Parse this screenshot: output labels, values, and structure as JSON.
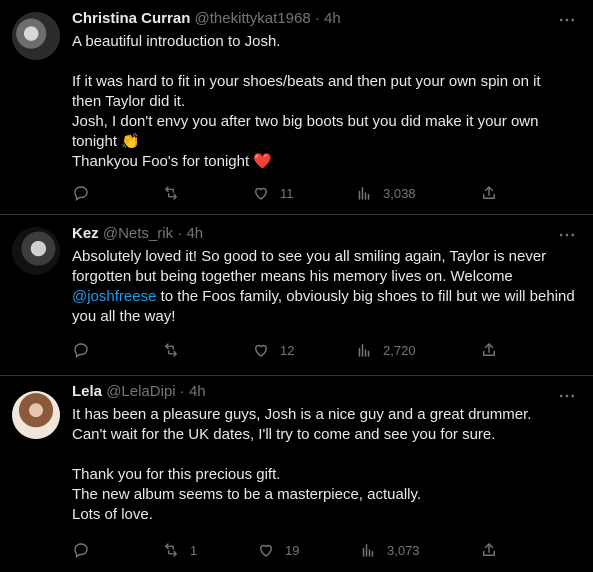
{
  "tweets": [
    {
      "name": "Christina Curran",
      "handle": "@thekittykat1968",
      "dot": "·",
      "time": "4h",
      "text_lines": [
        "A beautiful introduction to Josh.",
        "",
        "If it was hard to fit in your shoes/beats and then put your own spin on it",
        "then Taylor did it.",
        "Josh, I don't envy you after two big boots but you did make it your own",
        "tonight 👏",
        "Thankyou Foo's for tonight ❤️"
      ],
      "actions": {
        "reply": "",
        "retweet": "",
        "like": "11",
        "views": "3,038"
      }
    },
    {
      "name": "Kez",
      "handle": "@Nets_rik",
      "dot": "·",
      "time": "4h",
      "text_before_mention": "Absolutely loved it! So good to see you all smiling again, Taylor is never forgotten but being together means his memory lives on. Welcome",
      "mention": "@joshfreese",
      "text_after_mention": "to the Foos family, obviously big shoes to fill but we will behind you all the way!",
      "actions": {
        "reply": "",
        "retweet": "",
        "like": "12",
        "views": "2,720"
      }
    },
    {
      "name": "Lela",
      "handle": "@LelaDipi",
      "dot": "·",
      "time": "4h",
      "text_lines": [
        "It has been a pleasure guys, Josh is a nice guy and a great drummer.",
        "Can't wait for the UK dates, I'll try to come and see you for sure.",
        "",
        "Thank you for this precious gift.",
        "The new album seems to be a masterpiece, actually.",
        "Lots of love."
      ],
      "actions": {
        "reply": "",
        "retweet": "1",
        "like": "19",
        "views": "3,073"
      }
    }
  ],
  "colors": {
    "background": "#000000",
    "text": "#e7e9ea",
    "secondary": "#71767b",
    "link": "#1d9bf0",
    "divider": "#2f3336"
  },
  "icons": [
    "more-icon",
    "reply-icon",
    "retweet-icon",
    "like-icon",
    "views-icon",
    "share-icon"
  ]
}
